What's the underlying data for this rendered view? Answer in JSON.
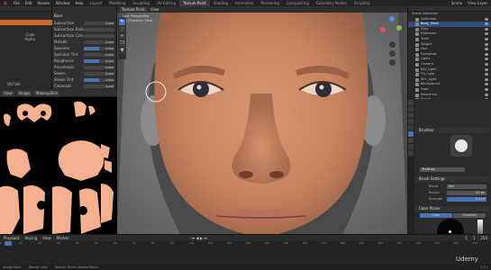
{
  "topbar": {
    "menus": [
      "File",
      "Edit",
      "Render",
      "Window",
      "Help"
    ],
    "workspaces": [
      "Layout",
      "Modeling",
      "Sculpting",
      "UV Editing",
      "Texture Paint",
      "Shading",
      "Animation",
      "Rendering",
      "Compositing",
      "Geometry Nodes",
      "Scripting"
    ],
    "active_workspace": "Texture Paint",
    "scene": "Scene",
    "view_layer": "View Layer"
  },
  "left_panel": {
    "labels": [
      "Color",
      "Alpha"
    ],
    "base_color": "#c96a2a",
    "value": "Old Val"
  },
  "mid_panel": {
    "title": "Base",
    "rows": [
      {
        "name": "Subsurface",
        "value": "0.000",
        "fill": 0
      },
      {
        "name": "Subsurface Radius",
        "value": "",
        "fill": 0
      },
      {
        "name": "Subsurface Color",
        "value": "",
        "fill": 0
      },
      {
        "name": "Metallic",
        "value": "0.000",
        "fill": 0
      },
      {
        "name": "Specular",
        "value": "0.500",
        "fill": 0.5
      },
      {
        "name": "Specular Tint",
        "value": "0.000",
        "fill": 0
      },
      {
        "name": "Roughness",
        "value": "0.500",
        "fill": 0.5
      },
      {
        "name": "Anisotropic",
        "value": "0.000",
        "fill": 0
      },
      {
        "name": "Sheen",
        "value": "0.000",
        "fill": 0
      },
      {
        "name": "Sheen Tint",
        "value": "0.500",
        "fill": 0.5
      },
      {
        "name": "Clearcoat",
        "value": "0.000",
        "fill": 0
      }
    ]
  },
  "image_editor": {
    "buttons": [
      "View",
      "Image",
      "MakeupSkin"
    ]
  },
  "viewport": {
    "header": [
      "Texture Paint",
      "View"
    ],
    "info": [
      "User Perspective",
      "(1) Character_Face"
    ]
  },
  "outliner": {
    "title": "Scene Collection",
    "rows": [
      {
        "name": "Collection",
        "selected": false
      },
      {
        "name": "Body_Mesh",
        "selected": true
      },
      {
        "name": "Eyes",
        "selected": false
      },
      {
        "name": "Eyebrows",
        "selected": false
      },
      {
        "name": "Teeth",
        "selected": false
      },
      {
        "name": "Tongue",
        "selected": false
      },
      {
        "name": "Hair",
        "selected": false
      },
      {
        "name": "Eyelashes",
        "selected": false
      },
      {
        "name": "Lights",
        "selected": false
      },
      {
        "name": "Camera",
        "selected": false
      },
      {
        "name": "Key_Light",
        "selected": false
      },
      {
        "name": "Fill_Light",
        "selected": false
      },
      {
        "name": "Rim_Light",
        "selected": false
      },
      {
        "name": "Background",
        "selected": false
      },
      {
        "name": "Floor",
        "selected": false
      },
      {
        "name": "Reference",
        "selected": false
      },
      {
        "name": "Sculpt",
        "selected": false
      }
    ]
  },
  "properties": {
    "brushes_section": "Brushes",
    "brush_name": "TexDraw",
    "brush_settings": "Brush Settings",
    "blend_label": "Blend",
    "blend_value": "Mix",
    "radius_label": "Radius",
    "radius_value": "50 px",
    "strength_label": "Strength",
    "strength_value": "0.119",
    "color_picker": "Color Picker",
    "color_tabs": [
      "Color",
      "Gradient"
    ],
    "paint_color": "#f2f2f2"
  },
  "timeline": {
    "menus": [
      "Playback",
      "Keying",
      "View",
      "Marker"
    ],
    "frame_current": "1",
    "start": "1",
    "end": "250",
    "ruler": [
      "0",
      "10",
      "20",
      "30",
      "40",
      "50",
      "60",
      "70",
      "80",
      "90",
      "100",
      "110",
      "120",
      "130",
      "140",
      "150",
      "160",
      "170",
      "180",
      "190",
      "200",
      "210",
      "220",
      "230",
      "240",
      "250"
    ]
  },
  "status": {
    "items": [
      "Image Paint",
      "Rotate View",
      "Texture Paint Context Menu"
    ],
    "version": "3.3.1"
  },
  "watermark": "Udemy"
}
